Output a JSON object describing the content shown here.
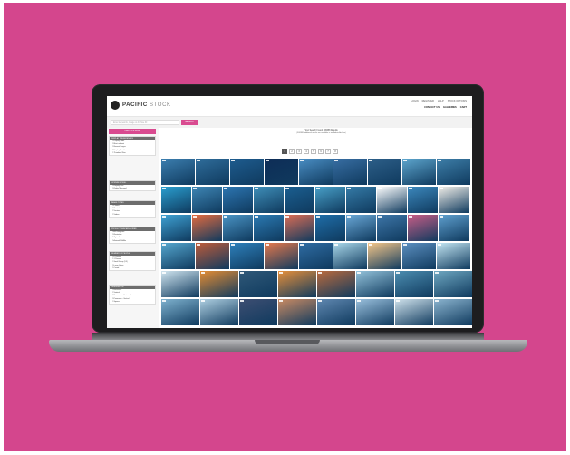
{
  "colors": {
    "background": "#d4468d",
    "accent": "#d94b90"
  },
  "site": {
    "brand_strong": "PACIFIC",
    "brand_light": "STOCK",
    "top_links": [
      "LOGIN",
      "REGISTER",
      "HELP",
      "STOCK OPTIONS"
    ],
    "sub_links": [
      "CONTACT US",
      "GALLERIES",
      "CART"
    ]
  },
  "search": {
    "placeholder": "Enter keywords, Image or Archive ID",
    "button": "SEARCH"
  },
  "sidebar": {
    "filter_button": "APPLY FILTERS",
    "sections": [
      {
        "title": "DISPLAY PREFERENCES",
        "rows": [
          "Display Order",
          "Most relevant",
          "Newest Images",
          "Display Results",
          "Thumbnail Size"
        ]
      },
      {
        "title": "LICENSE MODEL",
        "rows": [
          "Royalty Free",
          "Rights Managed"
        ]
      },
      {
        "title": "IMAGE TYPES",
        "rows": [
          "Photos",
          "Illustrations",
          "Vectors",
          "Videos"
        ]
      },
      {
        "title": "PRODUCT SUBCATEGORIES",
        "rows": [
          "All Categories",
          "Illustration",
          "Agriculture",
          "Animals/Wildlife"
        ]
      },
      {
        "title": "NUMBER OF PEOPLE",
        "rows": [
          "0 Person",
          "1 Person",
          "Small Group (2-3)",
          "Large Group",
          "Crowd"
        ]
      },
      {
        "title": "ORIENTATION",
        "rows": [
          "Horizontal",
          "Vertical",
          "Panoramic - Horizontal",
          "Panoramic - Vertical",
          "Square"
        ]
      }
    ]
  },
  "results": {
    "summary": "Your Search Found 308388 Results",
    "note": "(308388 additional results are available in our Admin Archive)"
  },
  "pagination": [
    "1",
    "2",
    "3",
    "4",
    "5",
    "6",
    "7",
    "8"
  ],
  "gallery_rows": [
    [
      "#3c7fb0",
      "#2f6d9b",
      "#1e5c8f",
      "#0e2d57",
      "#4a8ec4",
      "#386ea3",
      "#2d5f89",
      "#5ea7cf",
      "#3e7fa9"
    ],
    [
      "#2a9fd0",
      "#3e86b5",
      "#2d76b2",
      "#3f8fb9",
      "#1b5f91",
      "#48a0c8",
      "#357ba7",
      "#ffffff",
      "#3c88bd",
      "#f2efe9"
    ],
    [
      "#3fa2d4",
      "#e36b3f",
      "#4a94c5",
      "#2b7ab3",
      "#dc6d55",
      "#1f6ea9",
      "#6aa8d7",
      "#3e76a8",
      "#c85d86",
      "#5fa0cf"
    ],
    [
      "#55a7cf",
      "#bd5b3a",
      "#2e80bb",
      "#e4784c",
      "#2f6ca3",
      "#a9d7e9",
      "#f5c789",
      "#5c8fc0",
      "#c3e6f3"
    ],
    [
      "#cfe4ef",
      "#e38c33",
      "#2f5878",
      "#e58f3a",
      "#b96a3d",
      "#93c2da",
      "#4c8db0",
      "#6ea7c1"
    ],
    [
      "#7fb2cf",
      "#aecfe1",
      "#3d4e72",
      "#c98a63",
      "#5f87b0",
      "#9ac0dd",
      "#cfe2ec",
      "#8bb4cf"
    ]
  ]
}
